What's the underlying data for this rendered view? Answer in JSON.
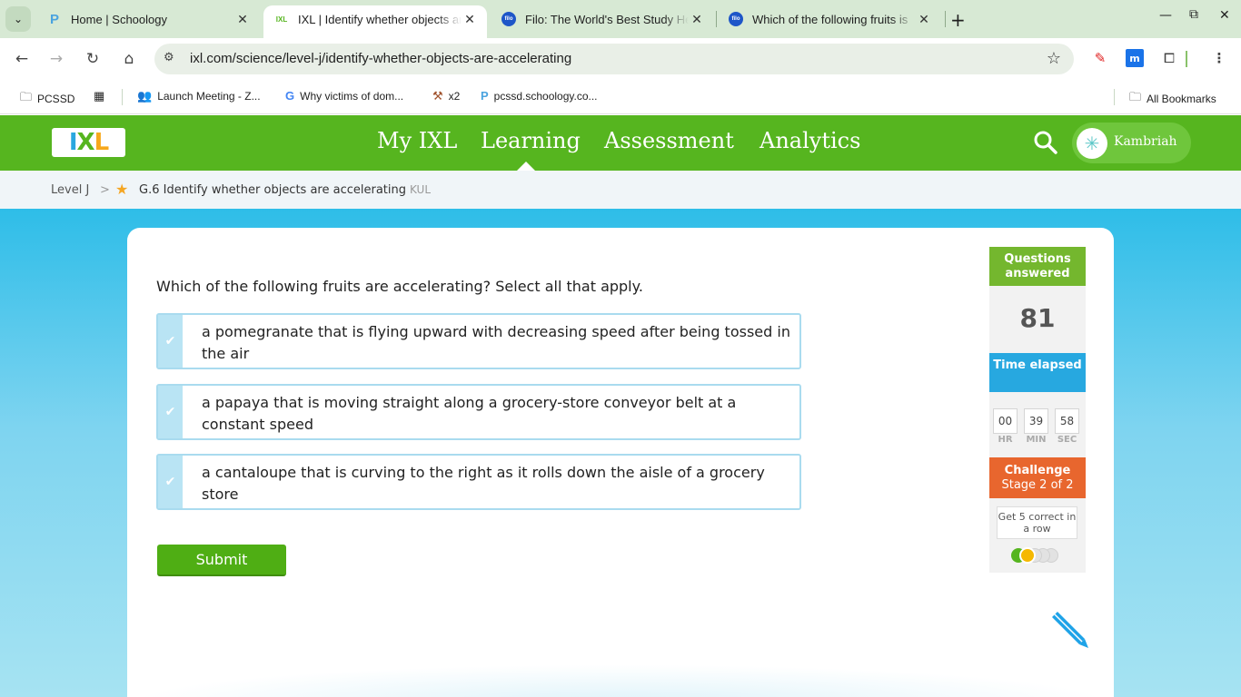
{
  "browser": {
    "tabs": [
      {
        "title": "Home | Schoology",
        "favicon": "P",
        "active": false
      },
      {
        "title": "IXL | Identify whether objects are accelerating",
        "favicon": "IXL",
        "active": true
      },
      {
        "title": "Filo: The World's Best Study Help",
        "favicon": "filo",
        "active": false
      },
      {
        "title": "Which of the following fruits is",
        "favicon": "filo",
        "active": false
      }
    ],
    "url": "ixl.com/science/level-j/identify-whether-objects-are-accelerating",
    "bookmarks": [
      {
        "label": "PCSSD",
        "icon": "folder-icon"
      },
      {
        "label": "",
        "icon": "apps-grid-icon"
      },
      {
        "label": "Launch Meeting - Z...",
        "icon": "zoom-icon"
      },
      {
        "label": "Why victims of dom...",
        "icon": "google-icon"
      },
      {
        "label": "x2",
        "icon": "x2-icon"
      },
      {
        "label": "pcssd.schoology.co...",
        "icon": "schoology-icon"
      }
    ],
    "all_bookmarks": "All Bookmarks"
  },
  "ixl": {
    "logo": "IXL",
    "nav": [
      "My IXL",
      "Learning",
      "Assessment",
      "Analytics"
    ],
    "active_nav": "Learning",
    "user": "Kambriah"
  },
  "breadcrumb": {
    "level": "Level J",
    "skill": "G.6 Identify whether objects are accelerating",
    "code": "KUL"
  },
  "question": {
    "prompt": "Which of the following fruits are accelerating? Select all that apply.",
    "options": [
      "a pomegranate that is flying upward with decreasing speed after being tossed in the air",
      "a papaya that is moving straight along a grocery-store conveyor belt at a constant speed",
      "a cantaloupe that is curving to the right as it rolls down the aisle of a grocery store"
    ],
    "submit": "Submit"
  },
  "stats": {
    "questions_answered_label": "Questions answered",
    "questions_answered": "81",
    "time_elapsed_label": "Time elapsed",
    "time": {
      "hr": "00",
      "min": "39",
      "sec": "58"
    },
    "time_labels": {
      "hr": "HR",
      "min": "MIN",
      "sec": "SEC"
    },
    "challenge_label": "Challenge",
    "challenge_stage": "Stage 2 of 2",
    "challenge_goal": "Get 5 correct in a row",
    "challenge_progress": 2,
    "challenge_total": 5
  },
  "colors": {
    "ixl_green": "#56b51f",
    "questions_green": "#74b72e",
    "time_blue": "#27a8e0",
    "challenge_orange": "#e8662e"
  }
}
